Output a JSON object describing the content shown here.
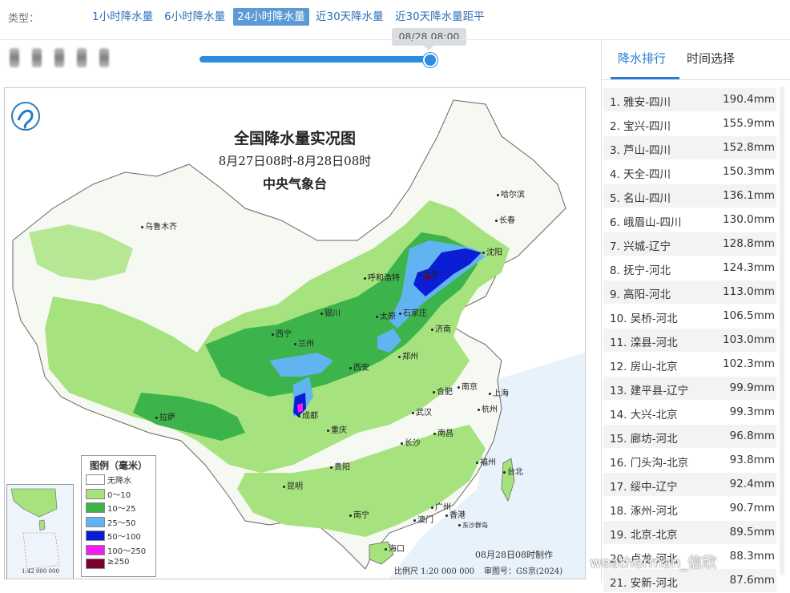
{
  "header": {
    "type_label": "类型：",
    "tabs": [
      {
        "label": "1小时降水量",
        "active": false
      },
      {
        "label": "6小时降水量",
        "active": false
      },
      {
        "label": "24小时降水量",
        "active": true
      },
      {
        "label": "近30天降水量",
        "active": false
      },
      {
        "label": "近30天降水量距平",
        "active": false
      }
    ],
    "slider": {
      "tooltip": "08/28 08:00",
      "progress": 1.0
    }
  },
  "map": {
    "title": "全国降水量实况图",
    "period": "8月27日08时-8月28日08时",
    "agency": "中央气象台",
    "legend_title": "图例（毫米）",
    "legend": [
      {
        "label": "无降水",
        "color": "#ffffff"
      },
      {
        "label": "0～10",
        "color": "#a6e27d"
      },
      {
        "label": "10～25",
        "color": "#3cb44b"
      },
      {
        "label": "25～50",
        "color": "#62b4f0"
      },
      {
        "label": "50～100",
        "color": "#0a1ed6"
      },
      {
        "label": "100～250",
        "color": "#f01ef0"
      },
      {
        "label": "≥250",
        "color": "#7a0032"
      }
    ],
    "made_time": "08月28日08时制作",
    "scale": "比例尺 1:20 000 000",
    "review": "审图号：GS京(2024)",
    "inset_scale": "1:42 000 000",
    "cities": [
      "乌鲁木齐",
      "哈尔滨",
      "长春",
      "沈阳",
      "呼和浩特",
      "北京",
      "银川",
      "太原",
      "石家庄",
      "西宁",
      "兰州",
      "济南",
      "郑州",
      "西安",
      "合肥",
      "南京",
      "上海",
      "拉萨",
      "成都",
      "武汉",
      "杭州",
      "重庆",
      "长沙",
      "南昌",
      "贵阳",
      "福州",
      "台北",
      "昆明",
      "南宁",
      "广州",
      "澳门",
      "香港",
      "海口",
      "东沙群岛"
    ]
  },
  "sidebar": {
    "tabs": [
      {
        "label": "降水排行",
        "active": true
      },
      {
        "label": "时间选择",
        "active": false
      }
    ],
    "ranking": [
      {
        "name": "1. 雅安-四川",
        "value": "190.4mm"
      },
      {
        "name": "2. 宝兴-四川",
        "value": "155.9mm"
      },
      {
        "name": "3. 芦山-四川",
        "value": "152.8mm"
      },
      {
        "name": "4. 天全-四川",
        "value": "150.3mm"
      },
      {
        "name": "5. 名山-四川",
        "value": "136.1mm"
      },
      {
        "name": "6. 峨眉山-四川",
        "value": "130.0mm"
      },
      {
        "name": "7. 兴城-辽宁",
        "value": "128.8mm"
      },
      {
        "name": "8. 抚宁-河北",
        "value": "124.3mm"
      },
      {
        "name": "9. 高阳-河北",
        "value": "113.0mm"
      },
      {
        "name": "10. 吴桥-河北",
        "value": "106.5mm"
      },
      {
        "name": "11. 滦县-河北",
        "value": "103.0mm"
      },
      {
        "name": "12. 房山-北京",
        "value": "102.3mm"
      },
      {
        "name": "13. 建平县-辽宁",
        "value": "99.9mm"
      },
      {
        "name": "14. 大兴-北京",
        "value": "99.3mm"
      },
      {
        "name": "15. 廊坊-河北",
        "value": "96.8mm"
      },
      {
        "name": "16. 门头沟-北京",
        "value": "93.8mm"
      },
      {
        "name": "17. 绥中-辽宁",
        "value": "92.4mm"
      },
      {
        "name": "18. 涿州-河北",
        "value": "90.7mm"
      },
      {
        "name": "19. 北京-北京",
        "value": "89.5mm"
      },
      {
        "name": "20. 卢龙-河北",
        "value": "88.3mm"
      },
      {
        "name": "21. 安新-河北",
        "value": "87.6mm"
      }
    ]
  },
  "watermark": "weatherman_信欣",
  "colors": {
    "accent": "#2a7dd1",
    "tab_active": "#5b9ad5"
  }
}
